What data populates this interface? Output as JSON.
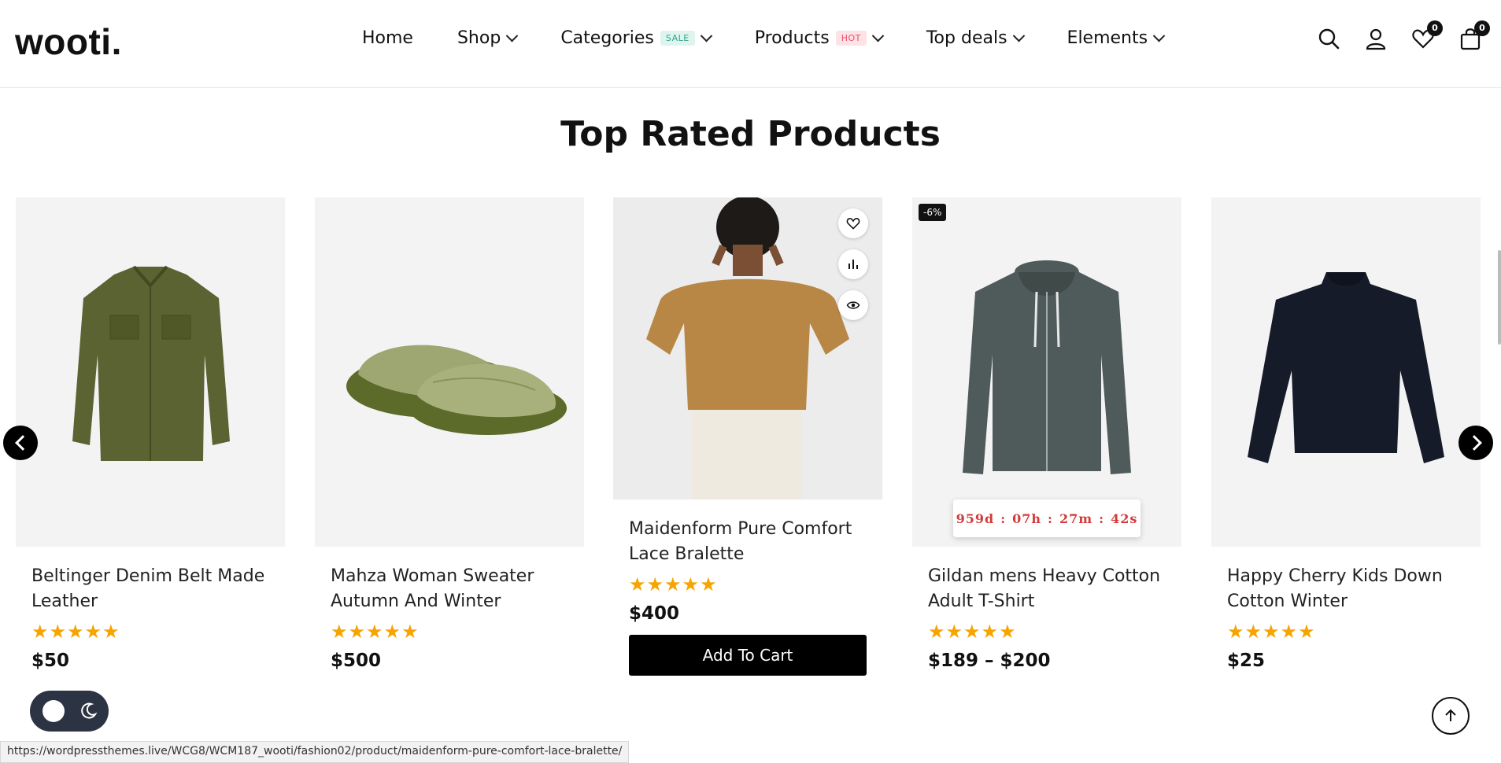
{
  "header": {
    "logo": "wooti.",
    "nav": [
      {
        "label": "Home"
      },
      {
        "label": "Shop"
      },
      {
        "label": "Categories",
        "badge": "SALE"
      },
      {
        "label": "Products",
        "badge": "HOT"
      },
      {
        "label": "Top deals"
      },
      {
        "label": "Elements"
      }
    ],
    "wishlist_count": "0",
    "cart_count": "0"
  },
  "section": {
    "title": "Top Rated Products"
  },
  "products": [
    {
      "title_line1": "Beltinger Denim Belt Made",
      "title_line2": "Leather",
      "rating": 5,
      "stars": "★★★★★",
      "price": "$50"
    },
    {
      "title_line1": "Mahza Woman Sweater",
      "title_line2": "Autumn And Winter",
      "rating": 5,
      "stars": "★★★★★",
      "price": "$500"
    },
    {
      "title_line1": "Maidenform Pure Comfort",
      "title_line2": "Lace Bralette",
      "rating": 5,
      "stars": "★★★★★",
      "price": "$400",
      "button": "Add To Cart"
    },
    {
      "title_line1": "Gildan mens Heavy Cotton",
      "title_line2": "Adult T-Shirt",
      "rating": 5,
      "stars": "★★★★★",
      "price": "$189 – $200",
      "discount": "-6%",
      "countdown": {
        "d": "959d",
        "h": "07h",
        "m": "27m",
        "s": "42s"
      }
    },
    {
      "title_line1": "Happy Cherry Kids Down",
      "title_line2": "Cotton Winter",
      "rating": 5,
      "stars": "★★★★★",
      "price": "$25"
    }
  ],
  "status_url": "https://wordpressthemes.live/WCG8/WCM187_wooti/fashion02/product/maidenform-pure-comfort-lace-bralette/",
  "icons": {
    "search": "search-icon",
    "account": "user-icon",
    "wishlist": "heart-icon",
    "cart": "bag-icon",
    "prev": "chevron-left-icon",
    "next": "chevron-right-icon",
    "top": "arrow-up-icon"
  },
  "colors": {
    "star": "#f5a400",
    "countdown": "#d33a3a",
    "sale_badge": "#2aa887",
    "hot_badge": "#e9506c"
  }
}
